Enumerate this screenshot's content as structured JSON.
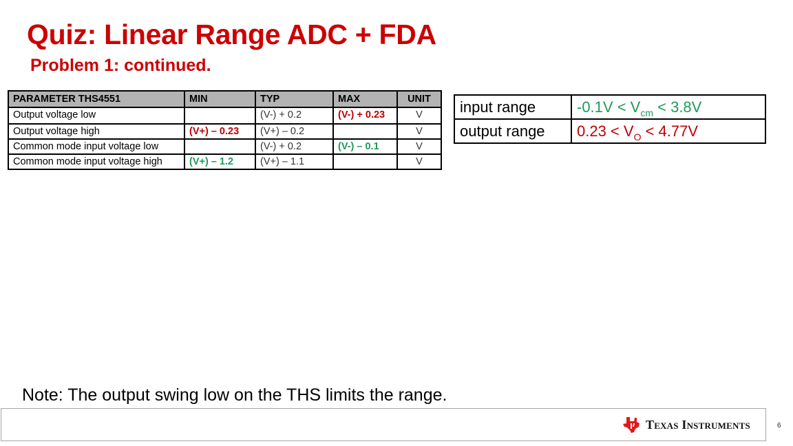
{
  "slide": {
    "title": "Quiz: Linear Range ADC + FDA",
    "subtitle": "Problem 1: continued.",
    "page_number": "6"
  },
  "spec_table": {
    "headers": [
      "PARAMETER THS4551",
      "MIN",
      "TYP",
      "MAX",
      "UNIT"
    ],
    "rows": [
      {
        "parameter": "Output voltage low",
        "min": "",
        "typ": "(V-) + 0.2",
        "max": "(V-) + 0.23",
        "unit": "V"
      },
      {
        "parameter": "Output voltage high",
        "min": "(V+) – 0.23",
        "typ": "(V+) – 0.2",
        "max": "",
        "unit": "V"
      },
      {
        "parameter": "Common mode input voltage low",
        "min": "",
        "typ": "(V-) + 0.2",
        "max": "(V-) – 0.1",
        "unit": "V"
      },
      {
        "parameter": "Common mode input voltage high",
        "min": "(V+) – 1.2",
        "typ": "(V+) – 1.1",
        "max": "",
        "unit": "V"
      }
    ],
    "highlight_colors": {
      "red": "#c00000",
      "green": "#1e9a5a"
    }
  },
  "range_table": {
    "rows": [
      {
        "label": "input range",
        "pre": "-0.1V < V",
        "sub": "cm",
        "post": " < 3.8V",
        "color": "green"
      },
      {
        "label": "output range",
        "pre": "0.23 < V",
        "sub": "O",
        "post": " < 4.77V",
        "color": "red"
      }
    ]
  },
  "note": "Note:  The output swing low on the THS limits the range.",
  "footer": {
    "logo_text": "Texas Instruments",
    "logo_icon": "ti-state-logo-icon"
  }
}
